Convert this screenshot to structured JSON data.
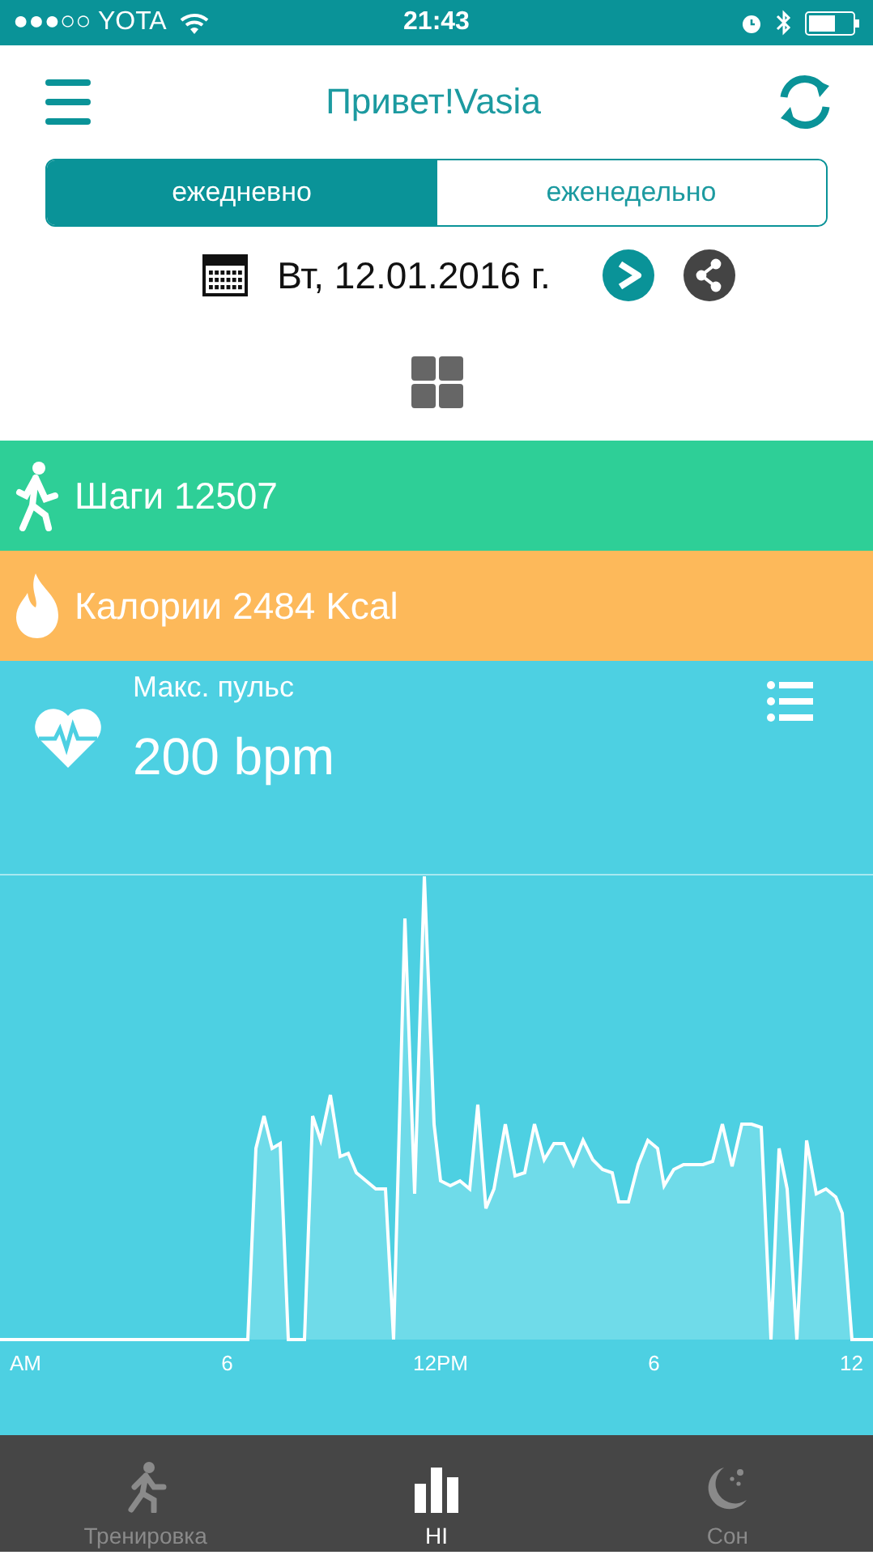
{
  "status_bar": {
    "carrier": "●●●○○ YOTA",
    "time": "21:43"
  },
  "header": {
    "title": "Привет!Vasia"
  },
  "period_tabs": [
    {
      "label": "ежедневно",
      "selected": true
    },
    {
      "label": "еженедельно",
      "selected": false
    }
  ],
  "date": "Вт, 12.01.2016 г.",
  "cards": [
    {
      "kind": "steps",
      "text": "Шаги 12507",
      "color": "#2ecf97"
    },
    {
      "kind": "calories",
      "text": "Калории 2484 Kcal",
      "color": "#fdb95a"
    }
  ],
  "heart": {
    "label": "Макс. пульс",
    "value": "200 bpm",
    "x_labels": [
      "AM",
      "6",
      "12PM",
      "6",
      "12"
    ]
  },
  "bottom_tabs": [
    {
      "kind": "workout",
      "label": "Тренировка",
      "selected": false
    },
    {
      "kind": "hi",
      "label": "HI",
      "selected": true
    },
    {
      "kind": "sleep",
      "label": "Сон",
      "selected": false
    }
  ]
}
